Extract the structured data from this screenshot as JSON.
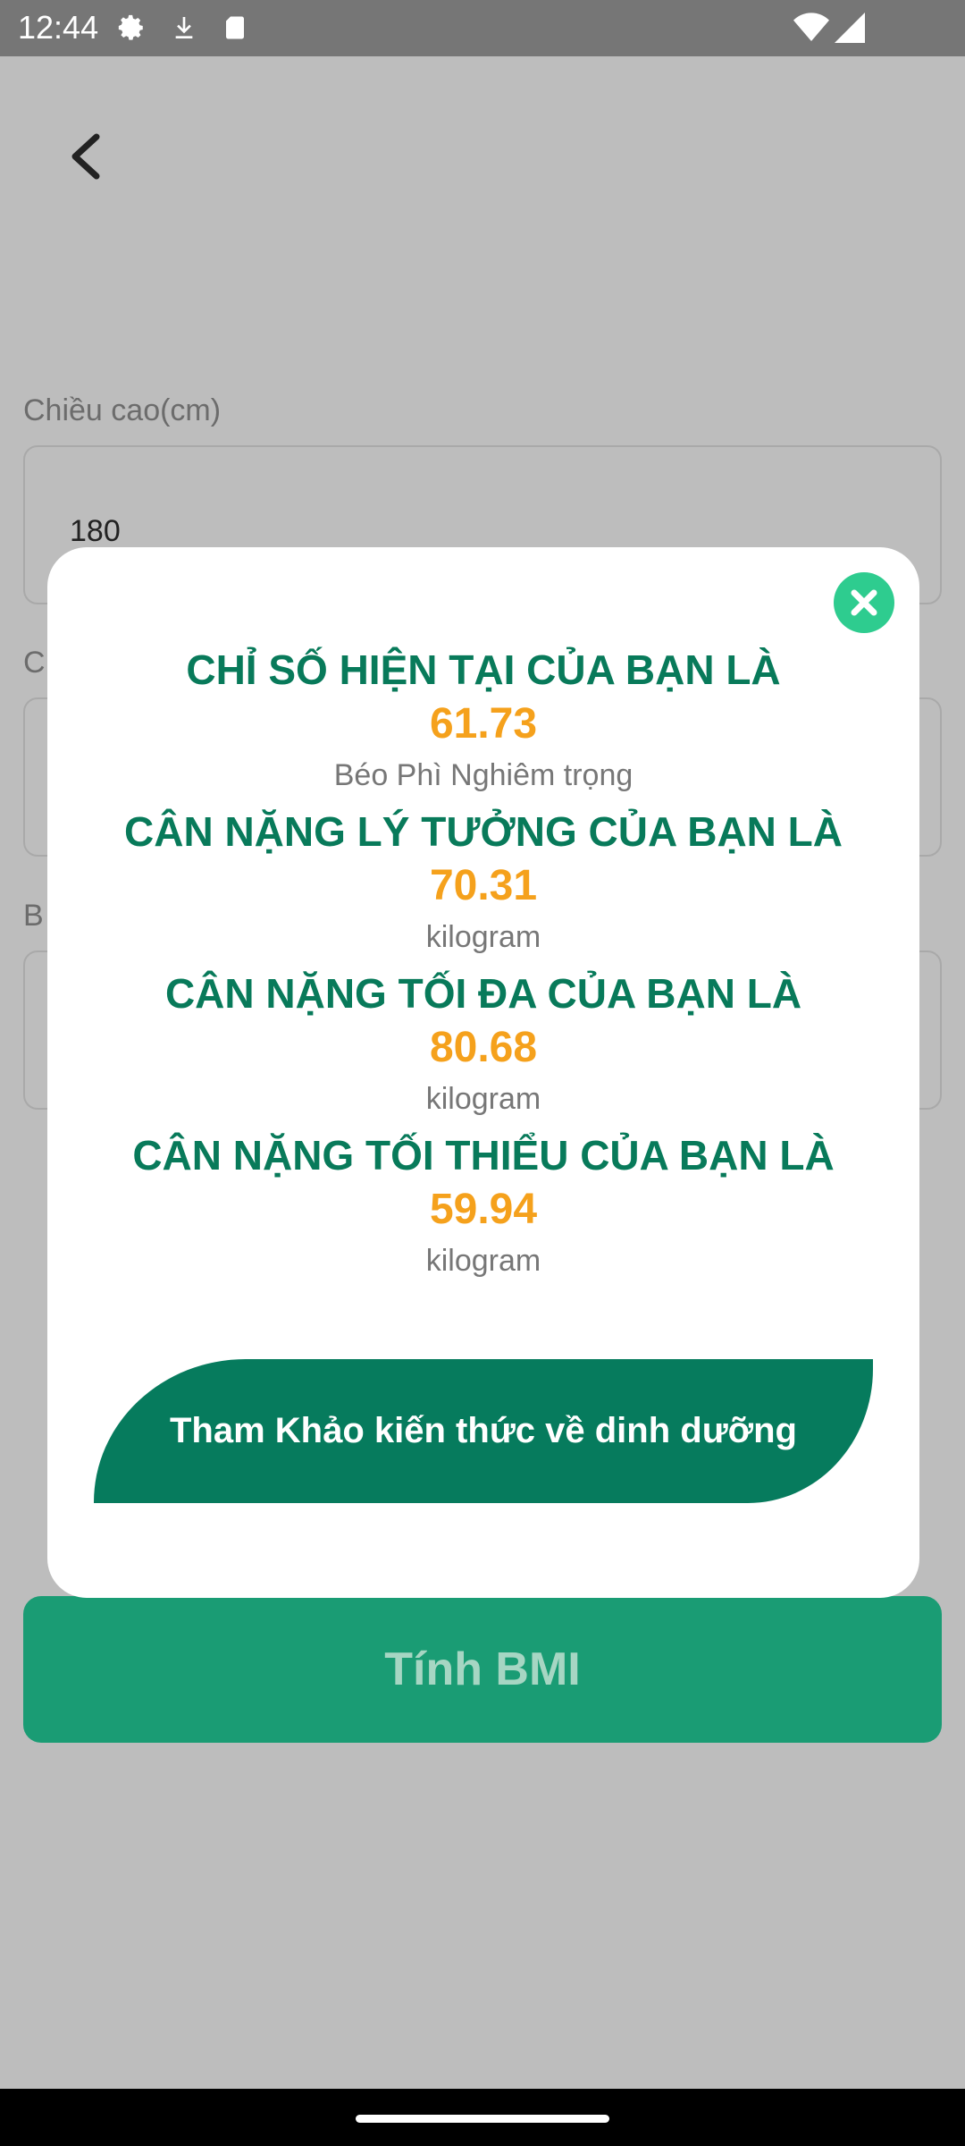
{
  "status_bar": {
    "time": "12:44",
    "icons": [
      "gear-icon",
      "download-icon",
      "sd-card-icon",
      "wifi-icon",
      "signal-icon"
    ]
  },
  "form": {
    "height_label": "Chiều cao(cm)",
    "height_value": "180",
    "weight_label_partial": "C",
    "bmi_label_partial": "B",
    "calc_button": "Tính BMI"
  },
  "dialog": {
    "results": [
      {
        "title": "CHỈ SỐ HIỆN TẠI CỦA BẠN LÀ",
        "value": "61.73",
        "unit": "Béo Phì Nghiêm trọng"
      },
      {
        "title": "CÂN NẶNG LÝ TƯỞNG CỦA BẠN LÀ",
        "value": "70.31",
        "unit": "kilogram"
      },
      {
        "title": "CÂN NẶNG TỐI ĐA CỦA BẠN LÀ",
        "value": "80.68",
        "unit": "kilogram"
      },
      {
        "title": "CÂN NẶNG TỐI THIỂU CỦA BẠN LÀ",
        "value": "59.94",
        "unit": "kilogram"
      }
    ],
    "nutrition_button": "Tham Khảo kiến thức về dinh dưỡng"
  },
  "colors": {
    "primary_green": "#087a5a",
    "value_orange": "#f5a11c",
    "close_green": "#2ecc8f",
    "button_green": "#1a9c74"
  }
}
